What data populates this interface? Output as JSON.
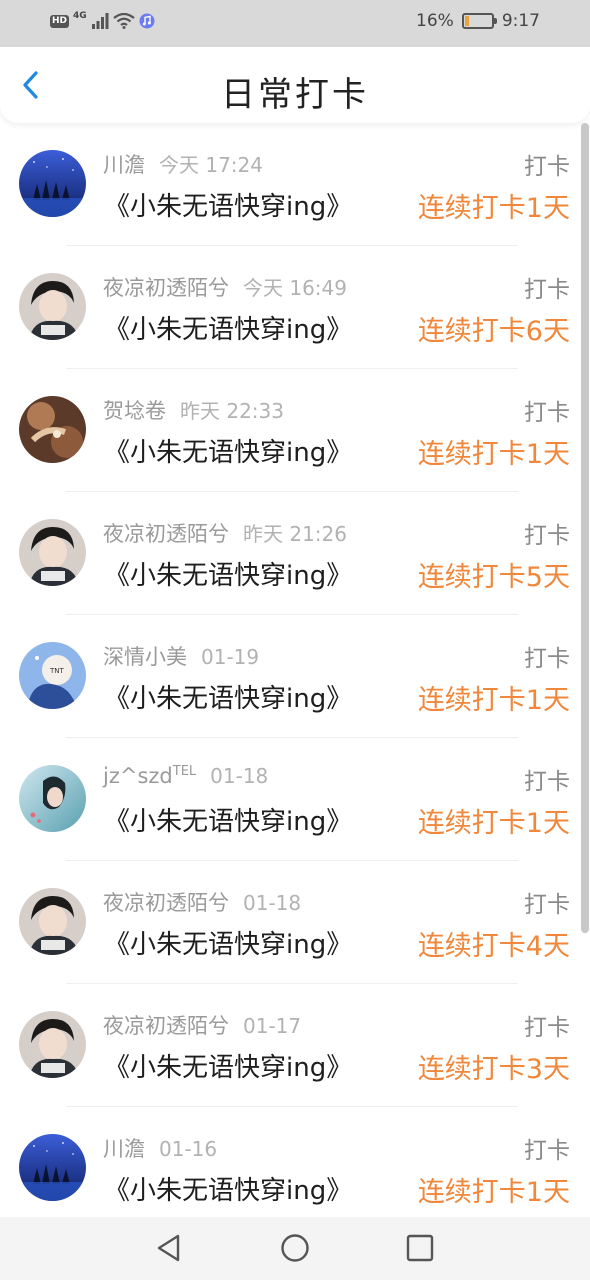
{
  "status_bar": {
    "hd": "HD",
    "network": "4G",
    "battery_percent": "16%",
    "battery_level": 0.16,
    "time": "9:17"
  },
  "header": {
    "title": "日常打卡",
    "back_icon": "chevron-left-icon"
  },
  "colors": {
    "accent": "#f0873a",
    "back": "#1e88e5",
    "name": "#9a9a9a"
  },
  "records": [
    {
      "name": "川澹",
      "name_sup": "",
      "time": "今天 17:24",
      "book": "《小朱无语快穿ing》",
      "label": "打卡",
      "streak": "连续打卡1天",
      "avatar": "night-sky"
    },
    {
      "name": "夜凉初透陌兮",
      "name_sup": "",
      "time": "今天 16:49",
      "book": "《小朱无语快穿ing》",
      "label": "打卡",
      "streak": "连续打卡6天",
      "avatar": "person"
    },
    {
      "name": "贺埝卷",
      "name_sup": "",
      "time": "昨天 22:33",
      "book": "《小朱无语快穿ing》",
      "label": "打卡",
      "streak": "连续打卡1天",
      "avatar": "warm"
    },
    {
      "name": "夜凉初透陌兮",
      "name_sup": "",
      "time": "昨天 21:26",
      "book": "《小朱无语快穿ing》",
      "label": "打卡",
      "streak": "连续打卡5天",
      "avatar": "person"
    },
    {
      "name": "深情小美",
      "name_sup": "",
      "time": "01-19",
      "book": "《小朱无语快穿ing》",
      "label": "打卡",
      "streak": "连续打卡1天",
      "avatar": "cartoon"
    },
    {
      "name": "jz^szd",
      "name_sup": "TEL",
      "time": "01-18",
      "book": "《小朱无语快穿ing》",
      "label": "打卡",
      "streak": "连续打卡1天",
      "avatar": "teal"
    },
    {
      "name": "夜凉初透陌兮",
      "name_sup": "",
      "time": "01-18",
      "book": "《小朱无语快穿ing》",
      "label": "打卡",
      "streak": "连续打卡4天",
      "avatar": "person"
    },
    {
      "name": "夜凉初透陌兮",
      "name_sup": "",
      "time": "01-17",
      "book": "《小朱无语快穿ing》",
      "label": "打卡",
      "streak": "连续打卡3天",
      "avatar": "person"
    },
    {
      "name": "川澹",
      "name_sup": "",
      "time": "01-16",
      "book": "《小朱无语快穿ing》",
      "label": "打卡",
      "streak": "连续打卡1天",
      "avatar": "night-sky"
    }
  ],
  "nav_bar": {
    "back": "triangle-back-icon",
    "home": "circle-home-icon",
    "recents": "square-recents-icon"
  }
}
